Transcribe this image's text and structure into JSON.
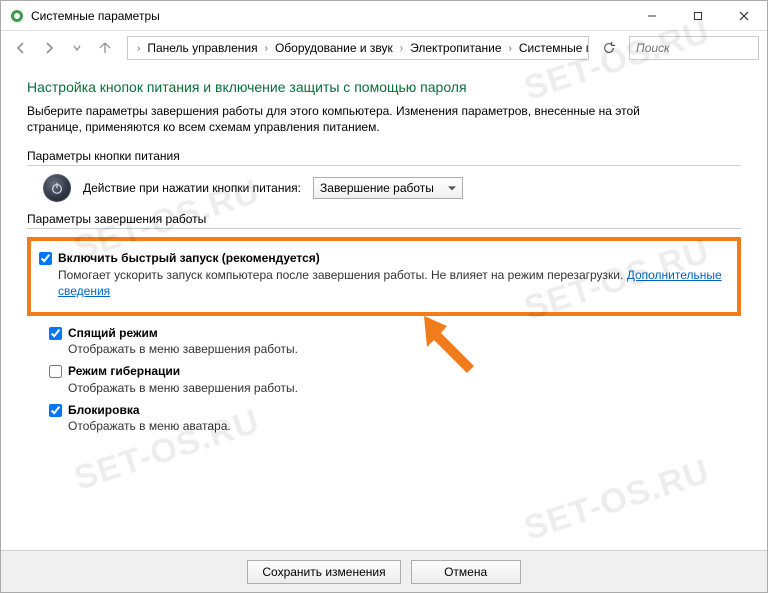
{
  "window": {
    "title": "Системные параметры"
  },
  "breadcrumb": {
    "items": [
      "Панель управления",
      "Оборудование и звук",
      "Электропитание",
      "Системные параметры"
    ]
  },
  "search": {
    "placeholder": "Поиск"
  },
  "page": {
    "heading": "Настройка кнопок питания и включение защиты с помощью пароля",
    "intro": "Выберите параметры завершения работы для этого компьютера. Изменения параметров, внесенные на этой странице, применяются ко всем схемам управления питанием."
  },
  "section_power_button": {
    "title": "Параметры кнопки питания",
    "row_label": "Действие при нажатии кнопки питания:",
    "dropdown_value": "Завершение работы"
  },
  "section_shutdown": {
    "title": "Параметры завершения работы",
    "fast_startup": {
      "label": "Включить быстрый запуск (рекомендуется)",
      "desc_prefix": "Помогает ускорить запуск компьютера после завершения работы. Не влияет на режим перезагрузки. ",
      "link": "Дополнительные сведения",
      "checked": true
    },
    "sleep": {
      "label": "Спящий режим",
      "desc": "Отображать в меню завершения работы.",
      "checked": true
    },
    "hibernate": {
      "label": "Режим гибернации",
      "desc": "Отображать в меню завершения работы.",
      "checked": false
    },
    "lock": {
      "label": "Блокировка",
      "desc": "Отображать в меню аватара.",
      "checked": true
    }
  },
  "buttons": {
    "save": "Сохранить изменения",
    "cancel": "Отмена"
  },
  "watermark": "SET-OS.RU"
}
